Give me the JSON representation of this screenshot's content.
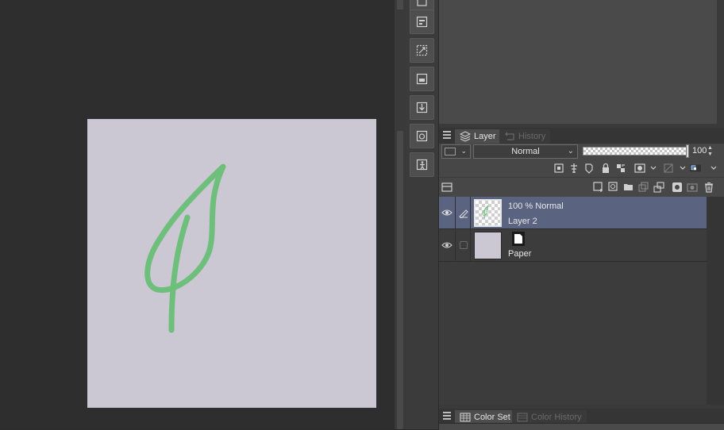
{
  "canvas": {
    "paper_color": "#cbc7d3",
    "stroke_color": "#6ebf7c"
  },
  "layer_panel": {
    "tabs": [
      {
        "label": "Layer",
        "icon": "layers-icon",
        "active": true
      },
      {
        "label": "History",
        "icon": "history-icon",
        "active": false
      }
    ],
    "blend_mode": "Normal",
    "opacity_value": "100",
    "opacity_percent": 100,
    "layers": [
      {
        "line1": "100 % Normal",
        "line2": "Layer 2",
        "selected": true,
        "visible": true
      },
      {
        "line1": "",
        "line2": "Paper",
        "selected": false,
        "visible": true
      }
    ]
  },
  "bottom_panel": {
    "tabs": [
      {
        "label": "Color Set",
        "icon": "color-set-icon",
        "active": true
      },
      {
        "label": "Color History",
        "icon": "color-history-icon",
        "active": false
      }
    ]
  },
  "colors": {
    "selection": "#5a6480",
    "accent_blue": "#4a88e0"
  }
}
